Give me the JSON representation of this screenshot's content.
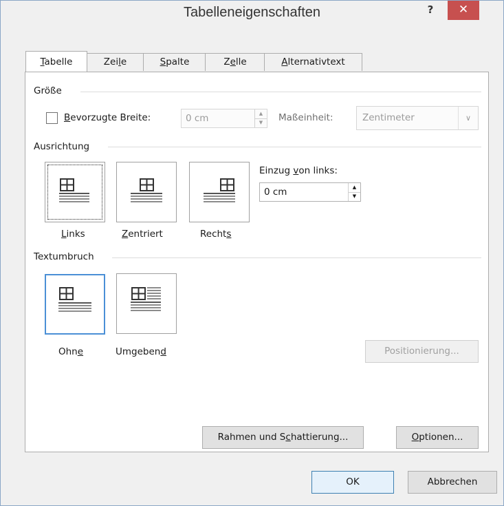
{
  "window": {
    "title": "Tabelleneigenschaften",
    "help_label": "?",
    "close_label": "✕"
  },
  "tabs": [
    {
      "pre": "",
      "u": "T",
      "post": "abelle"
    },
    {
      "pre": "Zei",
      "u": "l",
      "post": "e"
    },
    {
      "pre": "",
      "u": "S",
      "post": "palte"
    },
    {
      "pre": "Z",
      "u": "e",
      "post": "lle"
    },
    {
      "pre": "",
      "u": "A",
      "post": "lternativtext"
    }
  ],
  "groesse": {
    "heading": "Größe",
    "preferred_width": {
      "pre": "",
      "u": "B",
      "post": "evorzugte Breite:",
      "checked": false
    },
    "width_value": "0 cm",
    "unit_label": "Maßeinheit:",
    "unit_value": "Zentimeter"
  },
  "ausrichtung": {
    "heading": "Ausrichtung",
    "options": [
      {
        "pre": "",
        "u": "L",
        "post": "inks",
        "icon": "table-align-left-icon",
        "selected": true
      },
      {
        "pre": "",
        "u": "Z",
        "post": "entriert",
        "icon": "table-align-center-icon",
        "selected": false
      },
      {
        "pre": "Recht",
        "u": "s",
        "post": "",
        "icon": "table-align-right-icon",
        "selected": false
      }
    ],
    "indent_label": {
      "pre": "Einzug ",
      "u": "v",
      "post": "on links:"
    },
    "indent_value": "0 cm"
  },
  "textumbruch": {
    "heading": "Textumbruch",
    "options": [
      {
        "pre": "Ohn",
        "u": "e",
        "post": "",
        "icon": "text-wrap-none-icon",
        "selected": true
      },
      {
        "pre": "Umgeben",
        "u": "d",
        "post": "",
        "icon": "text-wrap-around-icon",
        "selected": false
      }
    ],
    "positioning_button": "Positionierung..."
  },
  "buttons": {
    "borders": {
      "pre": "Rahmen und S",
      "u": "c",
      "post": "hattierung..."
    },
    "options": {
      "pre": "",
      "u": "O",
      "post": "ptionen..."
    },
    "ok": "OK",
    "cancel": "Abbrechen"
  },
  "colors": {
    "close_red": "#c7504f",
    "selection_blue": "#4a8fd6"
  }
}
